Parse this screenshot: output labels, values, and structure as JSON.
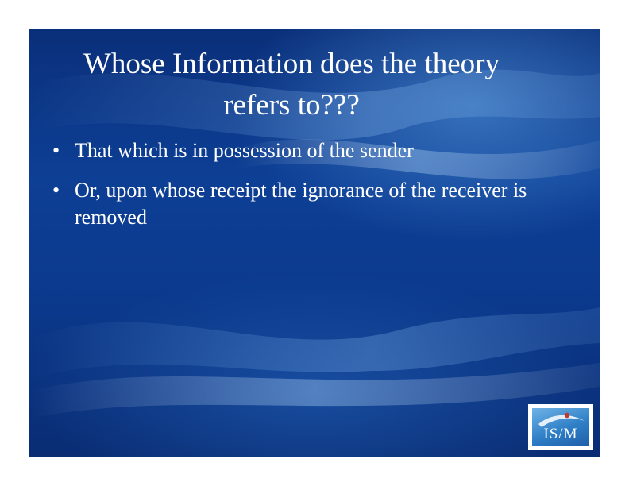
{
  "slide": {
    "title": "Whose Information does the theory refers to???",
    "bullets": [
      "That which is in possession of the sender",
      "Or, upon whose receipt the ignorance of the receiver is removed"
    ]
  },
  "logo": {
    "text": "IS/M"
  },
  "colors": {
    "background": "#0b3a8e",
    "text": "#ffffff",
    "logo_accent": "#2f7fc7"
  }
}
